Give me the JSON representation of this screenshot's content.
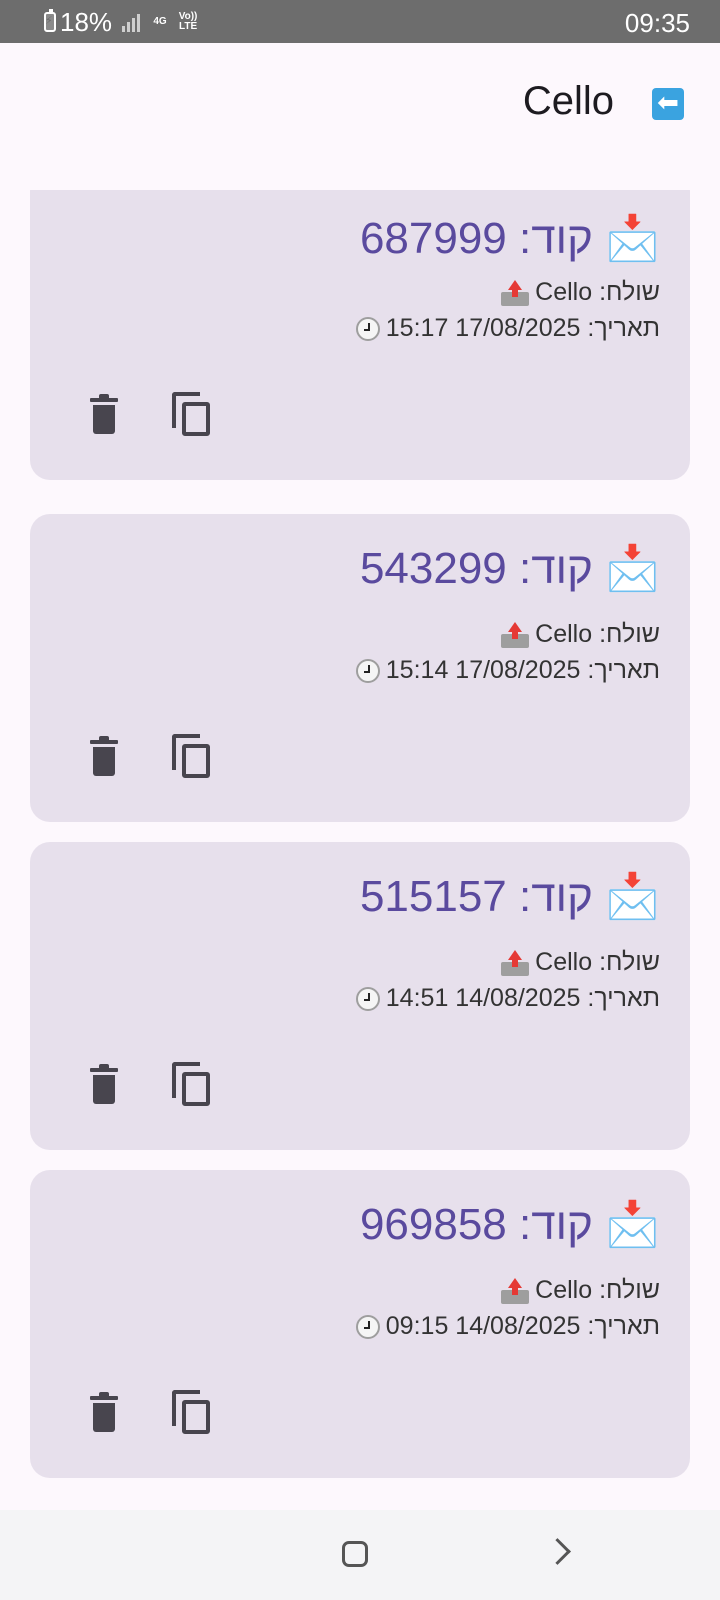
{
  "status_bar": {
    "battery": "18%",
    "network_type": "4G",
    "volte": "Vo)) LTE",
    "time": "09:35"
  },
  "app_bar": {
    "title": "Cello",
    "back_icon": "back-arrow-icon"
  },
  "messages": [
    {
      "code": "📩 קוד: 687999",
      "sender": "שולח: Cello",
      "date": "תאריך: 17/08/2025 15:17"
    },
    {
      "code": "📩 קוד: 543299",
      "sender": "שולח: Cello",
      "date": "תאריך: 17/08/2025 15:14"
    },
    {
      "code": "📩 קוד: 515157",
      "sender": "שולח: Cello",
      "date": "תאריך: 14/08/2025 14:51"
    },
    {
      "code": "📩 קוד: 969858",
      "sender": "שולח: Cello",
      "date": "תאריך: 14/08/2025 09:15"
    }
  ],
  "colors": {
    "card_bg": "#e7e0ec",
    "code_text": "#5a4a9e",
    "icon": "#48454e"
  }
}
